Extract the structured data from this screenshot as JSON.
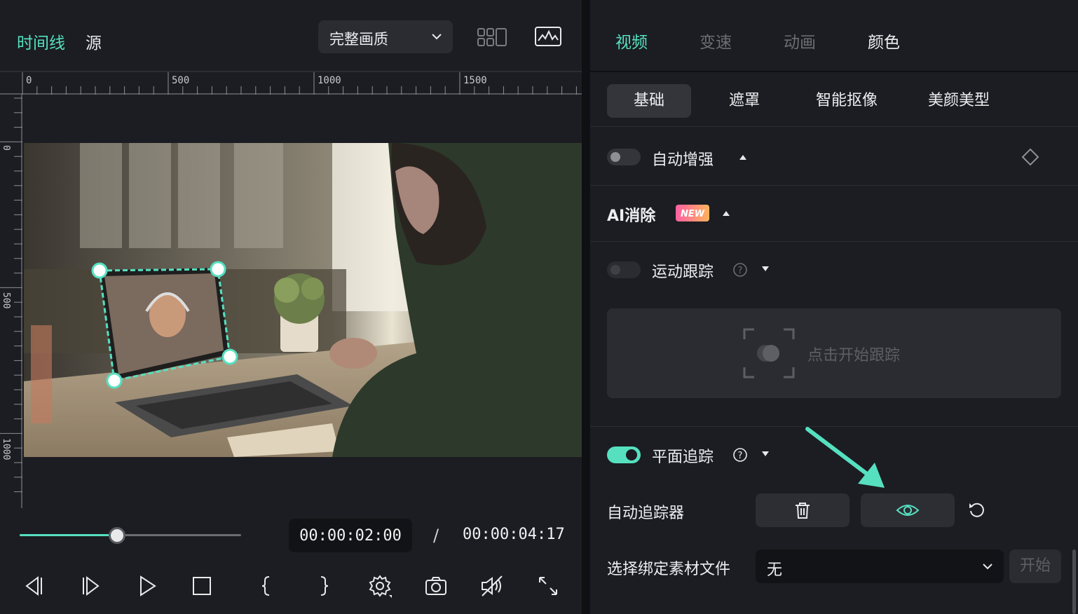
{
  "colors": {
    "accent": "#56e0c0",
    "panel": "#1b1d22",
    "new_badge_from": "#ff5fa2",
    "new_badge_to": "#ffb35c"
  },
  "player": {
    "tabs": [
      "时间线",
      "源"
    ],
    "active_tab": "时间线",
    "quality": "完整画质",
    "ruler_h_labels": [
      "0",
      "500",
      "1000",
      "1500"
    ],
    "ruler_v_labels": [
      "0",
      "500",
      "1000"
    ],
    "current_time": "00:00:02:00",
    "separator": "/",
    "total_time": "00:00:04:17",
    "progress_fraction": 0.44,
    "controls": [
      "prev-frame-icon",
      "next-frame-icon",
      "play-icon",
      "stop-icon",
      "mark-in-icon",
      "mark-out-icon",
      "settings-icon",
      "snapshot-icon",
      "audio-mute-icon",
      "fullscreen-icon"
    ]
  },
  "panel": {
    "tabs": [
      "视频",
      "变速",
      "动画",
      "颜色"
    ],
    "active_tab": "视频",
    "subtabs": [
      "基础",
      "遮罩",
      "智能抠像",
      "美颜美型"
    ],
    "active_subtab": "基础",
    "auto_enhance": "自动增强",
    "ai_remove": "AI消除",
    "new_badge": "NEW",
    "motion_tracking": "运动跟踪",
    "click_to_track": "点击开始跟踪",
    "planar_tracking": "平面追踪",
    "auto_tracker": "自动追踪器",
    "bind_label": "选择绑定素材文件",
    "bind_value": "无",
    "start": "开始"
  }
}
